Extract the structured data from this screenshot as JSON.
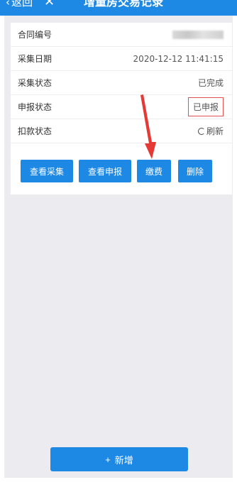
{
  "header": {
    "back_label": "返回",
    "close_symbol": "✕",
    "title": "增量房交易记录"
  },
  "record": {
    "rows": [
      {
        "label": "合同编号",
        "value": ""
      },
      {
        "label": "采集日期",
        "value": "2020-12-12 11:41:15"
      },
      {
        "label": "采集状态",
        "value": "已完成"
      },
      {
        "label": "申报状态",
        "value": "已申报"
      },
      {
        "label": "扣款状态",
        "value": "刷新"
      }
    ]
  },
  "actions": {
    "view_collection": "查看采集",
    "view_declaration": "查看申报",
    "pay": "缴费",
    "delete": "删除"
  },
  "footer": {
    "add_label": "新增",
    "add_symbol": "+"
  },
  "colors": {
    "primary": "#1e88e5",
    "highlight_border": "#e05252",
    "arrow": "#e53935"
  },
  "icons": [
    "chevron-left-icon",
    "close-icon",
    "refresh-icon",
    "plus-icon",
    "red-arrow-annotation"
  ]
}
